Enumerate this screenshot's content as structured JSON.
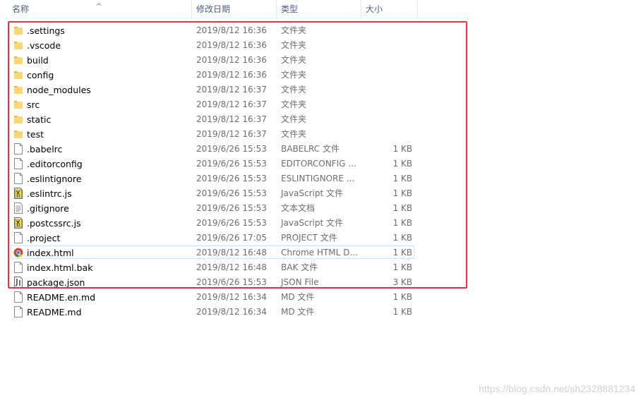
{
  "header": {
    "name_label": "名称",
    "date_label": "修改日期",
    "type_label": "类型",
    "size_label": "大小",
    "sort_indicator": "^"
  },
  "files": [
    {
      "name": ".settings",
      "date": "2019/8/12 16:36",
      "type": "文件夹",
      "size": "",
      "icon": "folder-icon"
    },
    {
      "name": ".vscode",
      "date": "2019/8/12 16:36",
      "type": "文件夹",
      "size": "",
      "icon": "folder-icon"
    },
    {
      "name": "build",
      "date": "2019/8/12 16:36",
      "type": "文件夹",
      "size": "",
      "icon": "folder-icon"
    },
    {
      "name": "config",
      "date": "2019/8/12 16:36",
      "type": "文件夹",
      "size": "",
      "icon": "folder-icon"
    },
    {
      "name": "node_modules",
      "date": "2019/8/12 16:37",
      "type": "文件夹",
      "size": "",
      "icon": "folder-icon"
    },
    {
      "name": "src",
      "date": "2019/8/12 16:37",
      "type": "文件夹",
      "size": "",
      "icon": "folder-icon"
    },
    {
      "name": "static",
      "date": "2019/8/12 16:37",
      "type": "文件夹",
      "size": "",
      "icon": "folder-icon"
    },
    {
      "name": "test",
      "date": "2019/8/12 16:37",
      "type": "文件夹",
      "size": "",
      "icon": "folder-icon"
    },
    {
      "name": ".babelrc",
      "date": "2019/6/26 15:53",
      "type": "BABELRC 文件",
      "size": "1 KB",
      "icon": "file-icon"
    },
    {
      "name": ".editorconfig",
      "date": "2019/6/26 15:53",
      "type": "EDITORCONFIG ...",
      "size": "1 KB",
      "icon": "file-icon"
    },
    {
      "name": ".eslintignore",
      "date": "2019/6/26 15:53",
      "type": "ESLINTIGNORE ...",
      "size": "1 KB",
      "icon": "file-icon"
    },
    {
      "name": ".eslintrc.js",
      "date": "2019/6/26 15:53",
      "type": "JavaScript 文件",
      "size": "1 KB",
      "icon": "js-file-icon"
    },
    {
      "name": ".gitignore",
      "date": "2019/6/26 15:53",
      "type": "文本文档",
      "size": "1 KB",
      "icon": "text-file-icon"
    },
    {
      "name": ".postcssrc.js",
      "date": "2019/6/26 15:53",
      "type": "JavaScript 文件",
      "size": "1 KB",
      "icon": "js-file-icon"
    },
    {
      "name": ".project",
      "date": "2019/6/26 17:05",
      "type": "PROJECT 文件",
      "size": "1 KB",
      "icon": "file-icon"
    },
    {
      "name": "index.html",
      "date": "2019/8/12 16:48",
      "type": "Chrome HTML D...",
      "size": "1 KB",
      "icon": "chrome-icon",
      "selected": true
    },
    {
      "name": "index.html.bak",
      "date": "2019/8/12 16:48",
      "type": "BAK 文件",
      "size": "1 KB",
      "icon": "file-icon"
    },
    {
      "name": "package.json",
      "date": "2019/6/26 15:53",
      "type": "JSON File",
      "size": "3 KB",
      "icon": "json-file-icon"
    },
    {
      "name": "README.en.md",
      "date": "2019/8/12 16:34",
      "type": "MD 文件",
      "size": "1 KB",
      "icon": "file-icon"
    },
    {
      "name": "README.md",
      "date": "2019/8/12 16:34",
      "type": "MD 文件",
      "size": "1 KB",
      "icon": "file-icon"
    }
  ],
  "colors": {
    "highlight_box": "#e8343c",
    "folder": "#f8d775",
    "selection_border": "#cce8ff"
  },
  "watermark": "https://blog.csdn.net/sh2328881234"
}
